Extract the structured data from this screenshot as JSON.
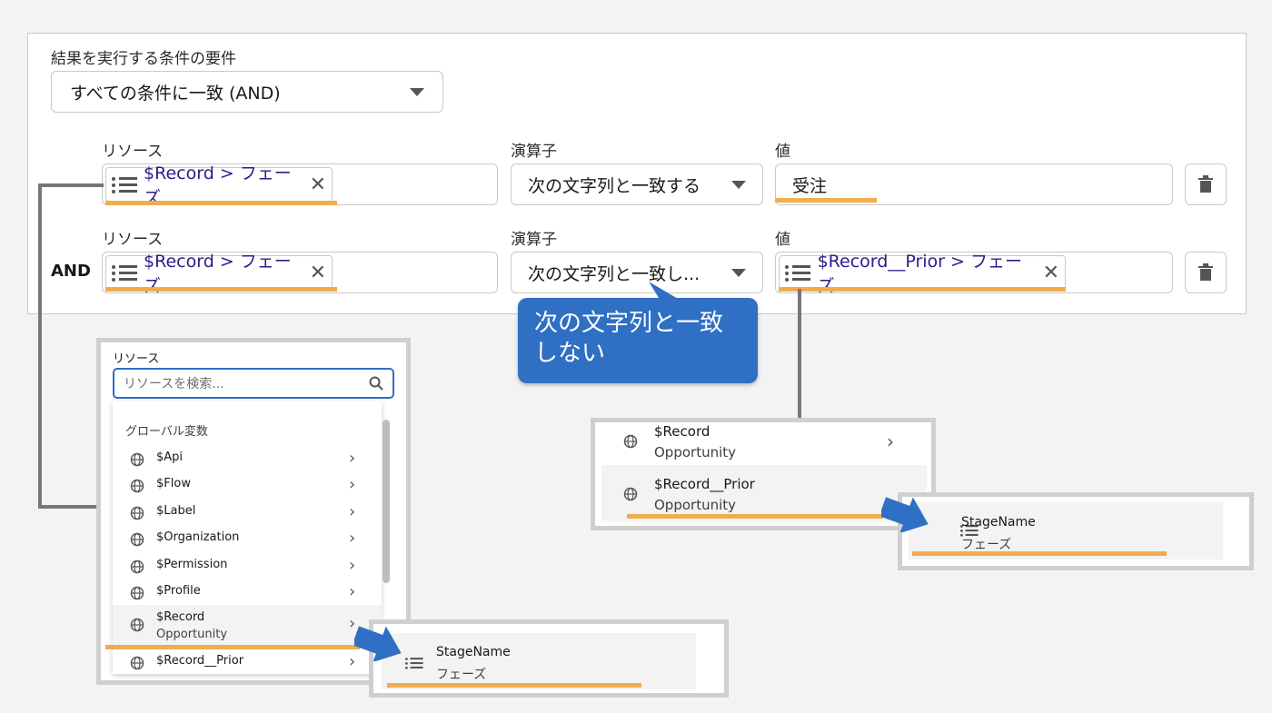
{
  "condition": {
    "section_label": "結果を実行する条件の要件",
    "select_value": "すべての条件に一致 (AND)"
  },
  "rows": [
    {
      "resource_label": "リソース",
      "resource_value": "$Record > フェーズ",
      "operator_label": "演算子",
      "operator_value": "次の文字列と一致する",
      "value_label": "値",
      "value": "受注"
    },
    {
      "logic": "AND",
      "resource_label": "リソース",
      "resource_value": "$Record > フェーズ",
      "operator_label": "演算子",
      "operator_value": "次の文字列と一致し...",
      "value_label": "値",
      "value": "$Record__Prior > フェーズ"
    }
  ],
  "tooltip": {
    "line1": "次の文字列と一致",
    "line2": "しない"
  },
  "resource_dropdown": {
    "label": "リソース",
    "search_placeholder": "リソースを検索...",
    "group": "グローバル変数",
    "items": [
      {
        "name": "$Api"
      },
      {
        "name": "$Flow"
      },
      {
        "name": "$Label"
      },
      {
        "name": "$Organization"
      },
      {
        "name": "$Permission"
      },
      {
        "name": "$Profile"
      },
      {
        "name": "$Record",
        "sub": "Opportunity"
      },
      {
        "name": "$Record__Prior"
      }
    ]
  },
  "stage_popup_left": {
    "name": "StageName",
    "sub": "フェーズ"
  },
  "record_panel": {
    "items": [
      {
        "name": "$Record",
        "sub": "Opportunity"
      },
      {
        "name": "$Record__Prior",
        "sub": "Opportunity"
      }
    ]
  },
  "stage_popup_right": {
    "name": "StageName",
    "sub": "フェーズ"
  },
  "colors": {
    "accent_blue": "#2f6fc4",
    "highlight": "#f0ad4e"
  }
}
